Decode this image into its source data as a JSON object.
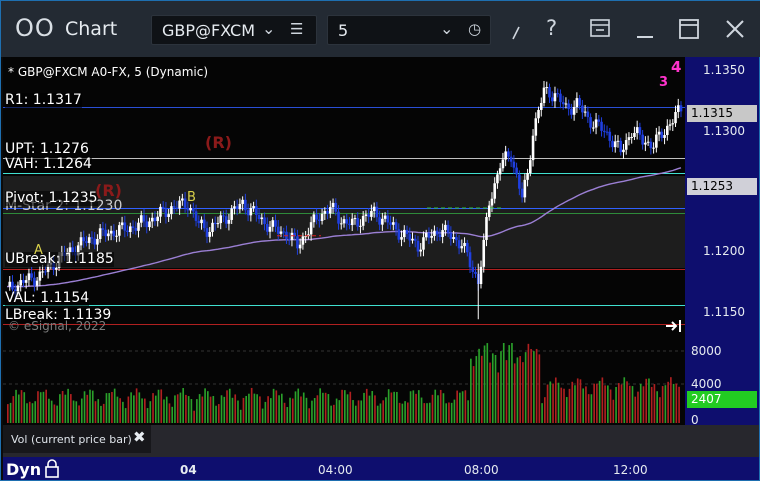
{
  "window": {
    "title": "Chart",
    "symbol": "GBP@FXCM",
    "interval": "5",
    "icon_names": [
      "menu-icon",
      "chevron-down-icon",
      "clock-icon",
      "pen-icon",
      "help-icon",
      "layout-icon",
      "minimize-icon",
      "maximize-icon",
      "close-icon"
    ],
    "accent_color": "#1e6fb0"
  },
  "study": {
    "title": "* GBP@FXCM A0-FX, 5 (Dynamic)",
    "watermark": "© eSignal, 2022"
  },
  "levels": {
    "r1": "R1: 1.1317",
    "upt": "UPT: 1.1276",
    "vah": "VAH: 1.1264",
    "pivot": "Pivot: 1.1235",
    "mstar": "M-Star 2: 1.1230",
    "ubreak": "UBreak: 1.1185",
    "val": "VAL: 1.1154",
    "lbreak": "LBreak: 1.1139"
  },
  "annotations": {
    "r_label": "(R)",
    "r_label2": "(R)",
    "b_label": "B",
    "a_label": "A",
    "top_marker": "4",
    "top_marker2": "3"
  },
  "price_axis": {
    "ticks": [
      "1.1350",
      "1.1300",
      "1.1250",
      "1.1200",
      "1.1150"
    ],
    "last_price": "1.1315",
    "vwap_value": "1.1253"
  },
  "volume_axis": {
    "ticks": [
      "8000",
      "4000",
      "0"
    ],
    "current_volume": "2407"
  },
  "volume_pane": {
    "label": "Vol (current price bar)"
  },
  "time_axis": {
    "ticks": [
      "04",
      "04:00",
      "08:00",
      "12:00"
    ]
  },
  "footer": {
    "mode": "Dyn"
  },
  "chart_data": {
    "type": "candlestick",
    "symbol": "GBP@FXCM",
    "interval": "5",
    "y_range": [
      1.1135,
      1.1365
    ],
    "price_levels": [
      {
        "name": "R1",
        "value": 1.1317
      },
      {
        "name": "UPT",
        "value": 1.1276
      },
      {
        "name": "VAH",
        "value": 1.1264
      },
      {
        "name": "Pivot",
        "value": 1.1235
      },
      {
        "name": "M-Star 2",
        "value": 1.123
      },
      {
        "name": "UBreak",
        "value": 1.1185
      },
      {
        "name": "VAL",
        "value": 1.1154
      },
      {
        "name": "LBreak",
        "value": 1.1139
      }
    ],
    "close_path": [
      [
        0,
        1.1168
      ],
      [
        6,
        1.1175
      ],
      [
        12,
        1.118
      ],
      [
        18,
        1.1192
      ],
      [
        24,
        1.1202
      ],
      [
        30,
        1.121
      ],
      [
        36,
        1.1215
      ],
      [
        42,
        1.1218
      ],
      [
        48,
        1.1222
      ],
      [
        54,
        1.1228
      ],
      [
        60,
        1.1236
      ],
      [
        66,
        1.124
      ],
      [
        70,
        1.1222
      ],
      [
        74,
        1.1218
      ],
      [
        78,
        1.1226
      ],
      [
        82,
        1.1232
      ],
      [
        86,
        1.124
      ],
      [
        90,
        1.1232
      ],
      [
        94,
        1.1224
      ],
      [
        98,
        1.1218
      ],
      [
        102,
        1.1215
      ],
      [
        106,
        1.1205
      ],
      [
        110,
        1.1218
      ],
      [
        114,
        1.123
      ],
      [
        118,
        1.1236
      ],
      [
        122,
        1.1226
      ],
      [
        126,
        1.1222
      ],
      [
        130,
        1.1228
      ],
      [
        134,
        1.1232
      ],
      [
        138,
        1.1226
      ],
      [
        142,
        1.1218
      ],
      [
        146,
        1.1212
      ],
      [
        150,
        1.1205
      ],
      [
        154,
        1.1212
      ],
      [
        158,
        1.1218
      ],
      [
        162,
        1.1213
      ],
      [
        166,
        1.1206
      ],
      [
        170,
        1.1185
      ],
      [
        172,
        1.1176
      ],
      [
        174,
        1.1205
      ],
      [
        176,
        1.124
      ],
      [
        180,
        1.1272
      ],
      [
        184,
        1.128
      ],
      [
        186,
        1.1262
      ],
      [
        188,
        1.1245
      ],
      [
        190,
        1.1262
      ],
      [
        192,
        1.13
      ],
      [
        196,
        1.1332
      ],
      [
        200,
        1.133
      ],
      [
        204,
        1.1318
      ],
      [
        208,
        1.1322
      ],
      [
        212,
        1.131
      ],
      [
        216,
        1.1303
      ],
      [
        220,
        1.1295
      ],
      [
        224,
        1.1282
      ],
      [
        228,
        1.13
      ],
      [
        232,
        1.1292
      ],
      [
        236,
        1.1288
      ],
      [
        240,
        1.13
      ],
      [
        244,
        1.1312
      ],
      [
        246,
        1.1317
      ]
    ],
    "volume_ticks": [
      0,
      4000,
      8000
    ],
    "x_ticks": [
      "04",
      "04:00",
      "08:00",
      "12:00"
    ]
  }
}
